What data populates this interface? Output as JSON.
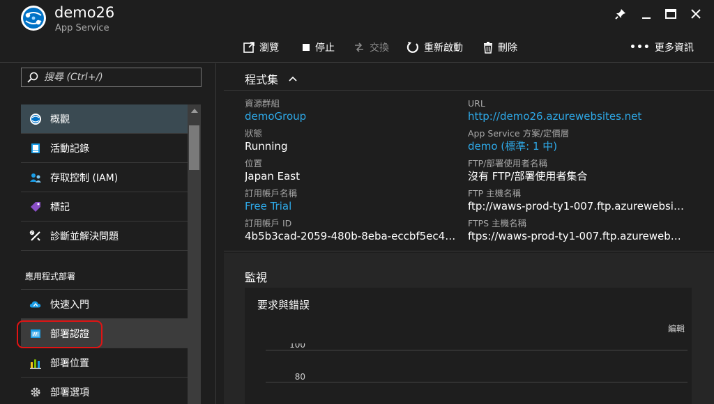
{
  "header": {
    "title": "demo26",
    "subtitle": "App Service",
    "colors": {
      "accent": "#2ea9e8",
      "logo": "#0072c6"
    }
  },
  "toolbar": {
    "browse": "瀏覽",
    "stop": "停止",
    "swap": "交換",
    "restart": "重新啟動",
    "delete": "刪除",
    "more": "更多資訊"
  },
  "sidebar": {
    "search_placeholder": "搜尋 (Ctrl+/)",
    "items": [
      {
        "label": "概觀",
        "icon": "app-service-icon"
      },
      {
        "label": "活動記錄",
        "icon": "activity-log-icon"
      },
      {
        "label": "存取控制 (IAM)",
        "icon": "users-icon"
      },
      {
        "label": "標記",
        "icon": "tag-icon"
      },
      {
        "label": "診斷並解決問題",
        "icon": "wrench-icon"
      }
    ],
    "section_title": "應用程式部署",
    "deploy_items": [
      {
        "label": "快速入門",
        "icon": "cloud-icon"
      },
      {
        "label": "部署認證",
        "icon": "credentials-icon"
      },
      {
        "label": "部署位置",
        "icon": "deployment-slots-icon"
      },
      {
        "label": "部署選項",
        "icon": "gear-icon"
      }
    ]
  },
  "essentials": {
    "title": "程式集",
    "left": [
      {
        "label": "資源群組",
        "value": "demoGroup"
      },
      {
        "label": "狀態",
        "value": "Running"
      },
      {
        "label": "位置",
        "value": "Japan East"
      },
      {
        "label": "訂用帳戶名稱",
        "value": "Free Trial"
      },
      {
        "label": "訂用帳戶 ID",
        "value": "4b5b3cad-2059-480b-8eba-eccbf5ec46..."
      }
    ],
    "right": [
      {
        "label": "URL",
        "value": "http://demo26.azurewebsites.net"
      },
      {
        "label": "App Service 方案/定價層",
        "value": "demo (標準: 1 中)"
      },
      {
        "label": "FTP/部署使用者名稱",
        "value": "沒有 FTP/部署使用者集合"
      },
      {
        "label": "FTP 主機名稱",
        "value": "ftp://waws-prod-ty1-007.ftp.azurewebsit..."
      },
      {
        "label": "FTPS 主機名稱",
        "value": "ftps://waws-prod-ty1-007.ftp.azurewebs..."
      }
    ]
  },
  "monitor": {
    "title": "監視",
    "chart_title": "要求與錯誤",
    "edit": "編輯"
  },
  "chart_data": {
    "type": "line",
    "title": "要求與錯誤",
    "ticks": [
      100,
      80
    ],
    "ylim": [
      80,
      100
    ],
    "series": []
  }
}
